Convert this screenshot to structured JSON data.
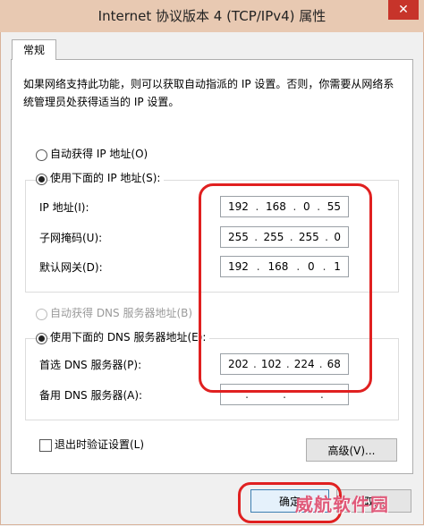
{
  "window": {
    "title": "Internet 协议版本 4 (TCP/IPv4) 属性",
    "close_label": "✕"
  },
  "tabs": [
    {
      "label": "常规"
    }
  ],
  "description": "如果网络支持此功能，则可以获取自动指派的 IP 设置。否则，你需要从网络系统管理员处获得适当的 IP 设置。",
  "ip_section": {
    "auto_label": "自动获得 IP 地址(O)",
    "manual_label": "使用下面的 IP 地址(S):",
    "selected": "manual",
    "fields": [
      {
        "label": "IP 地址(I):",
        "octets": [
          "192",
          "168",
          "0",
          "55"
        ]
      },
      {
        "label": "子网掩码(U):",
        "octets": [
          "255",
          "255",
          "255",
          "0"
        ]
      },
      {
        "label": "默认网关(D):",
        "octets": [
          "192",
          "168",
          "0",
          "1"
        ]
      }
    ]
  },
  "dns_section": {
    "auto_label": "自动获得 DNS 服务器地址(B)",
    "manual_label": "使用下面的 DNS 服务器地址(E):",
    "selected": "manual",
    "fields": [
      {
        "label": "首选 DNS 服务器(P):",
        "octets": [
          "202",
          "102",
          "224",
          "68"
        ]
      },
      {
        "label": "备用 DNS 服务器(A):",
        "octets": [
          "",
          "",
          "",
          ""
        ]
      }
    ]
  },
  "validate_label": "退出时验证设置(L)",
  "advanced_label": "高级(V)...",
  "ok_label": "确定",
  "cancel_label": "取消",
  "watermark": "威航软件园",
  "colors": {
    "annotation": "#e02020",
    "titlebar": "#e8c9b2",
    "close": "#c7342a"
  }
}
